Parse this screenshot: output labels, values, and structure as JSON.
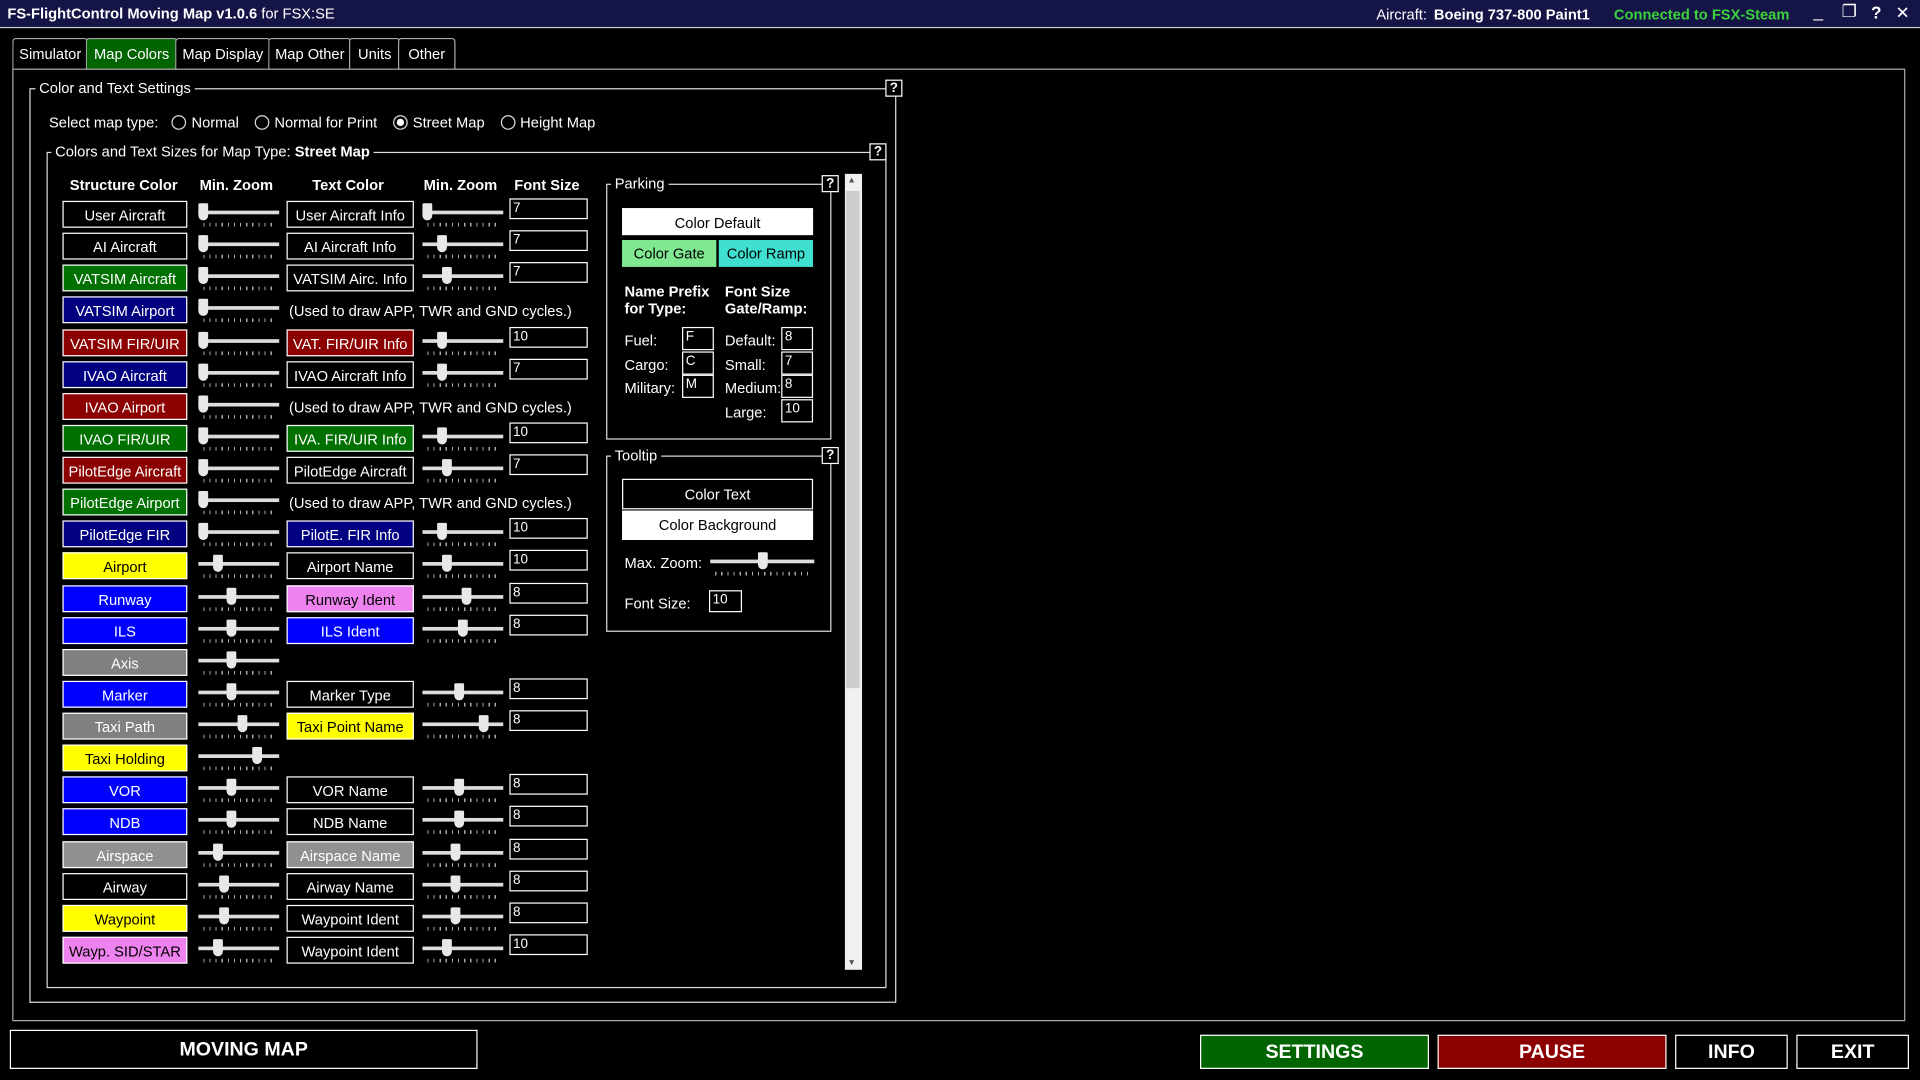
{
  "title": {
    "app": "FS-FlightControl Moving Map v1.0.6",
    "suffix": "for FSX:SE",
    "aircraft_label": "Aircraft:",
    "aircraft": "Boeing 737-800 Paint1",
    "status": "Connected to FSX-Steam",
    "status_color": "#3cd23c"
  },
  "window_controls": {
    "minimize": "_",
    "restore": "❐",
    "help": "?",
    "close": "✕"
  },
  "tabs": [
    {
      "label": "Simulator"
    },
    {
      "label": "Map Colors",
      "active": true
    },
    {
      "label": "Map Display"
    },
    {
      "label": "Map Other"
    },
    {
      "label": "Units"
    },
    {
      "label": "Other"
    }
  ],
  "settings": {
    "group_title": "Color and Text Settings",
    "map_type_label": "Select map type:",
    "map_types": [
      {
        "label": "Normal",
        "selected": false
      },
      {
        "label": "Normal for Print",
        "selected": false
      },
      {
        "label": "Street Map",
        "selected": true
      },
      {
        "label": "Height Map",
        "selected": false
      }
    ],
    "inner_title": "Colors and Text Sizes for Map Type:",
    "inner_type": "Street Map",
    "headers": {
      "structure": "Structure Color",
      "min_zoom": "Min. Zoom",
      "text": "Text Color",
      "min_zoom2": "Min. Zoom",
      "font_size": "Font Size"
    },
    "rows": [
      {
        "s": "User Aircraft",
        "sbg": "#000000",
        "sfg": "#ffffff",
        "sz": 0,
        "t": "User Aircraft Info",
        "tbg": "#000000",
        "tfg": "#ffffff",
        "tz": 0,
        "fs": "7"
      },
      {
        "s": "AI Aircraft",
        "sbg": "#000000",
        "sfg": "#ffffff",
        "sz": 0,
        "t": "AI Aircraft Info",
        "tbg": "#000000",
        "tfg": "#ffffff",
        "tz": 0.2,
        "fs": "7"
      },
      {
        "s": "VATSIM Aircraft",
        "sbg": "#007000",
        "sfg": "#ffffff",
        "sz": 0,
        "t": "VATSIM Airc. Info",
        "tbg": "#000000",
        "tfg": "#ffffff",
        "tz": 0.27,
        "fs": "7"
      },
      {
        "s": "VATSIM Airport",
        "sbg": "#000080",
        "sfg": "#ffffff",
        "sz": 0,
        "note": "(Used to draw APP, TWR and GND cycles.)"
      },
      {
        "s": "VATSIM FIR/UIR",
        "sbg": "#8b0000",
        "sfg": "#ffffff",
        "sz": 0,
        "t": "VAT. FIR/UIR Info",
        "tbg": "#8b0000",
        "tfg": "#ffffff",
        "tz": 0.2,
        "fs": "10"
      },
      {
        "s": "IVAO Aircraft",
        "sbg": "#000080",
        "sfg": "#ffffff",
        "sz": 0,
        "t": "IVAO Aircraft Info",
        "tbg": "#000000",
        "tfg": "#ffffff",
        "tz": 0.2,
        "fs": "7"
      },
      {
        "s": "IVAO Airport",
        "sbg": "#8b0000",
        "sfg": "#ffffff",
        "sz": 0,
        "note": "(Used to draw APP, TWR and GND cycles.)"
      },
      {
        "s": "IVAO FIR/UIR",
        "sbg": "#007000",
        "sfg": "#ffffff",
        "sz": 0,
        "t": "IVA. FIR/UIR Info",
        "tbg": "#007000",
        "tfg": "#ffffff",
        "tz": 0.2,
        "fs": "10"
      },
      {
        "s": "PilotEdge Aircraft",
        "sbg": "#8b0000",
        "sfg": "#ffffff",
        "sz": 0,
        "t": "PilotEdge Aircraft",
        "tbg": "#000000",
        "tfg": "#ffffff",
        "tz": 0.27,
        "fs": "7"
      },
      {
        "s": "PilotEdge Airport",
        "sbg": "#007000",
        "sfg": "#ffffff",
        "sz": 0,
        "note": "(Used to draw APP, TWR and GND cycles.)"
      },
      {
        "s": "PilotEdge FIR",
        "sbg": "#000080",
        "sfg": "#ffffff",
        "sz": 0,
        "t": "PilotE. FIR Info",
        "tbg": "#000080",
        "tfg": "#ffffff",
        "tz": 0.2,
        "fs": "10"
      },
      {
        "s": "Airport",
        "sbg": "#ffff00",
        "sfg": "#000000",
        "sz": 0.2,
        "t": "Airport Name",
        "tbg": "#000000",
        "tfg": "#ffffff",
        "tz": 0.27,
        "fs": "10"
      },
      {
        "s": "Runway",
        "sbg": "#0000ff",
        "sfg": "#ffffff",
        "sz": 0.4,
        "t": "Runway Ident",
        "tbg": "#ee82ee",
        "tfg": "#000000",
        "tz": 0.55,
        "fs": "8"
      },
      {
        "s": "ILS",
        "sbg": "#0000ff",
        "sfg": "#ffffff",
        "sz": 0.4,
        "t": "ILS Ident",
        "tbg": "#0000ff",
        "tfg": "#ffffff",
        "tz": 0.5,
        "fs": "8"
      },
      {
        "s": "Axis",
        "sbg": "#808080",
        "sfg": "#ffffff",
        "sz": 0.4
      },
      {
        "s": "Marker",
        "sbg": "#0000ff",
        "sfg": "#ffffff",
        "sz": 0.4,
        "t": "Marker Type",
        "tbg": "#000000",
        "tfg": "#ffffff",
        "tz": 0.45,
        "fs": "8"
      },
      {
        "s": "Taxi Path",
        "sbg": "#808080",
        "sfg": "#ffffff",
        "sz": 0.55,
        "t": "Taxi Point Name",
        "tbg": "#ffff00",
        "tfg": "#000000",
        "tz": 0.8,
        "fs": "8"
      },
      {
        "s": "Taxi Holding",
        "sbg": "#ffff00",
        "sfg": "#000000",
        "sz": 0.75
      },
      {
        "s": "VOR",
        "sbg": "#0000ff",
        "sfg": "#ffffff",
        "sz": 0.4,
        "t": "VOR Name",
        "tbg": "#000000",
        "tfg": "#ffffff",
        "tz": 0.45,
        "fs": "8"
      },
      {
        "s": "NDB",
        "sbg": "#0000ff",
        "sfg": "#ffffff",
        "sz": 0.4,
        "t": "NDB Name",
        "tbg": "#000000",
        "tfg": "#ffffff",
        "tz": 0.45,
        "fs": "8"
      },
      {
        "s": "Airspace",
        "sbg": "#909090",
        "sfg": "#ffffff",
        "sz": 0.2,
        "t": "Airspace Name",
        "tbg": "#909090",
        "tfg": "#ffffff",
        "tz": 0.4,
        "fs": "8"
      },
      {
        "s": "Airway",
        "sbg": "#000000",
        "sfg": "#ffffff",
        "sz": 0.3,
        "t": "Airway Name",
        "tbg": "#000000",
        "tfg": "#ffffff",
        "tz": 0.4,
        "fs": "8"
      },
      {
        "s": "Waypoint",
        "sbg": "#ffff00",
        "sfg": "#000000",
        "sz": 0.3,
        "t": "Waypoint Ident",
        "tbg": "#000000",
        "tfg": "#ffffff",
        "tz": 0.4,
        "fs": "8"
      },
      {
        "s": "Wayp. SID/STAR",
        "sbg": "#ee82ee",
        "sfg": "#000000",
        "sz": 0.2,
        "t": "Waypoint Ident",
        "tbg": "#000000",
        "tfg": "#ffffff",
        "tz": 0.27,
        "fs": "10"
      }
    ]
  },
  "parking": {
    "title": "Parking",
    "color_default": "Color Default",
    "color_gate": "Color Gate",
    "color_ramp": "Color Ramp",
    "gate_color": "#80e890",
    "ramp_color": "#40e0d0",
    "prefix_header1": "Name Prefix",
    "prefix_header2": "for Type:",
    "size_header1": "Font Size",
    "size_header2": "Gate/Ramp:",
    "fuel_label": "Fuel:",
    "fuel": "F",
    "cargo_label": "Cargo:",
    "cargo": "C",
    "military_label": "Military:",
    "military": "M",
    "default_label": "Default:",
    "default": "8",
    "small_label": "Small:",
    "small": "7",
    "medium_label": "Medium:",
    "medium": "8",
    "large_label": "Large:",
    "large": "10"
  },
  "tooltip": {
    "title": "Tooltip",
    "color_text": "Color Text",
    "color_background": "Color Background",
    "max_zoom_label": "Max. Zoom:",
    "max_zoom": 0.5,
    "font_size_label": "Font Size:",
    "font_size": "10"
  },
  "help": "?",
  "bottom": {
    "moving_map": "MOVING MAP",
    "settings": "SETTINGS",
    "pause": "PAUSE",
    "info": "INFO",
    "exit": "EXIT",
    "settings_color": "#006400",
    "pause_color": "#8b0000"
  }
}
